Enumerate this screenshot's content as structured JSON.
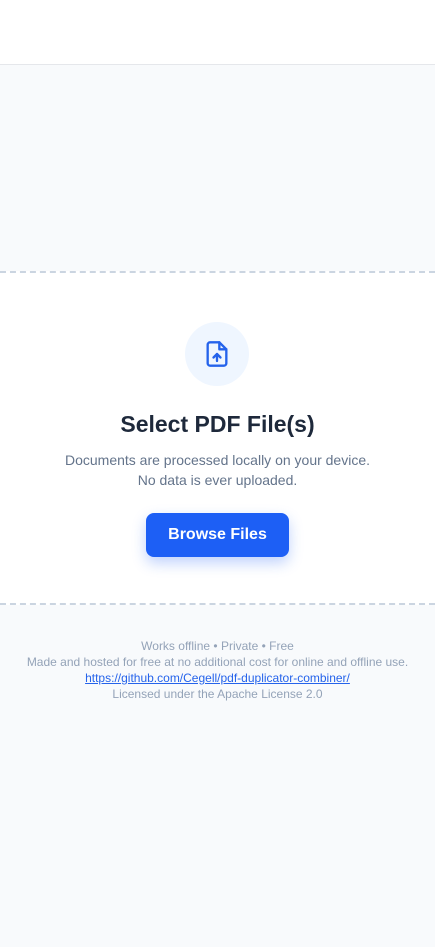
{
  "header": {},
  "upload": {
    "icon": "file-upload-icon",
    "title": "Select PDF File(s)",
    "description_line1": "Documents are processed locally on your device.",
    "description_line2": "No data is ever uploaded.",
    "browse_label": "Browse Files"
  },
  "footer": {
    "features": "Works offline • Private • Free",
    "hosting": "Made and hosted for free at no additional cost for online and offline use.",
    "repo_link": "https://github.com/Cegell/pdf-duplicator-combiner/",
    "license": "Licensed under the Apache License 2.0"
  },
  "colors": {
    "accent": "#1d5ff5",
    "icon_bg": "#eff6ff",
    "page_bg": "#f8fafc"
  }
}
